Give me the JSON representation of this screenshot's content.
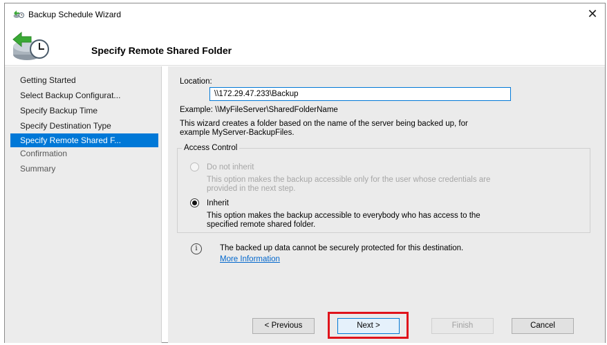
{
  "window": {
    "title": "Backup Schedule Wizard",
    "close_glyph": "✕"
  },
  "header": {
    "title": "Specify Remote Shared Folder",
    "icon": "backup-clock-icon"
  },
  "sidebar": {
    "items": [
      {
        "label": "Getting Started"
      },
      {
        "label": "Select Backup Configurat..."
      },
      {
        "label": "Specify Backup Time"
      },
      {
        "label": "Specify Destination Type"
      },
      {
        "label": "Specify Remote Shared F..."
      },
      {
        "label": "Confirmation"
      },
      {
        "label": "Summary"
      }
    ],
    "active_index": 4
  },
  "main": {
    "location_label": "Location:",
    "location_value": "\\\\172.29.47.233\\Backup",
    "example": "Example: \\\\MyFileServer\\SharedFolderName",
    "description_line1": "This wizard creates a folder based on the name of the server being backed up, for",
    "description_line2": "example MyServer-BackupFiles.",
    "access_control": {
      "title": "Access Control",
      "options": [
        {
          "label": "Do not inherit",
          "desc_line1": "This option makes the backup accessible only for the user whose credentials are",
          "desc_line2": "provided in the next step.",
          "enabled": false,
          "checked": false
        },
        {
          "label": "Inherit",
          "desc_line1": "This option makes the backup accessible to everybody who has access to the",
          "desc_line2": "specified remote shared folder.",
          "enabled": true,
          "checked": true
        }
      ]
    },
    "info_glyph": "i",
    "info_text": "The backed up data cannot be securely protected for this destination.",
    "more_info_link": "More Information"
  },
  "buttons": {
    "previous": "< Previous",
    "next": "Next >",
    "finish": "Finish",
    "cancel": "Cancel"
  },
  "colors": {
    "accent": "#0078d7",
    "highlight": "#e0131b",
    "sidebar_bg": "#ececec",
    "content_bg": "#ebebeb"
  }
}
